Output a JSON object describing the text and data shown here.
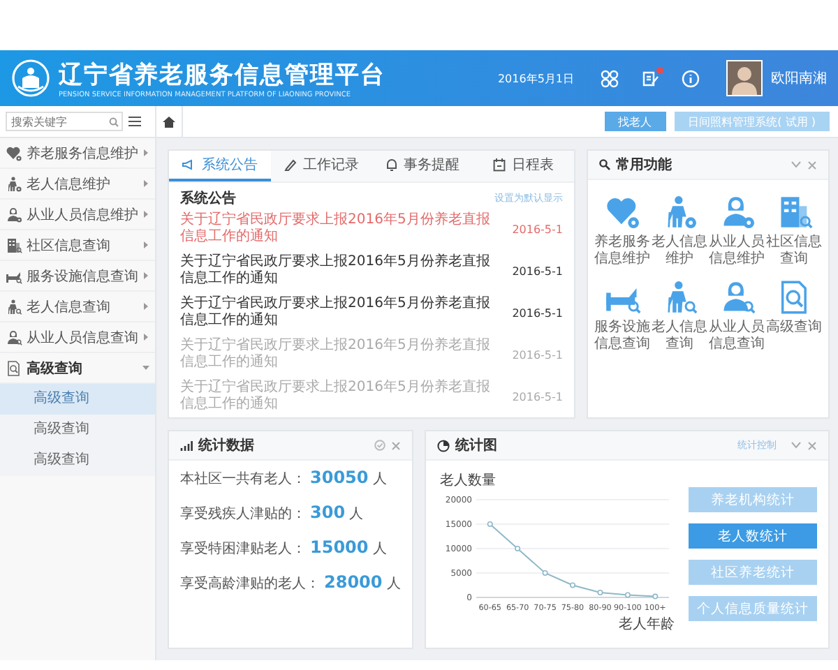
{
  "header": {
    "title": "辽宁省养老服务信息管理平台",
    "subtitle": "PENSION SERVICE INFORMATION MANAGEMENT PLATFORM OF LIAONING PROVINCE",
    "date": "2016年5月1日",
    "user": "欧阳南湘"
  },
  "toolbar": {
    "search": {
      "placeholder": "搜索关键字"
    },
    "buttons": [
      {
        "label": "找老人",
        "kind": "primary"
      },
      {
        "label": "日间照料管理系统( 试用 )",
        "kind": "light"
      }
    ]
  },
  "sidebar": {
    "items": [
      {
        "label": "养老服务信息维护",
        "expanded": false
      },
      {
        "label": "老人信息维护",
        "expanded": false
      },
      {
        "label": "从业人员信息维护",
        "expanded": false
      },
      {
        "label": "社区信息查询",
        "expanded": false
      },
      {
        "label": "服务设施信息查询",
        "expanded": false
      },
      {
        "label": "老人信息查询",
        "expanded": false
      },
      {
        "label": "从业人员信息查询",
        "expanded": false
      },
      {
        "label": "高级查询",
        "expanded": true,
        "children": [
          {
            "label": "高级查询",
            "selected": true
          },
          {
            "label": "高级查询",
            "selected": false
          },
          {
            "label": "高级查询",
            "selected": false
          }
        ]
      }
    ]
  },
  "notices": {
    "tabs": [
      {
        "label": "系统公告",
        "selected": true
      },
      {
        "label": "工作记录",
        "selected": false
      },
      {
        "label": "事务提醒",
        "selected": false
      },
      {
        "label": "日程表",
        "selected": false
      }
    ],
    "heading": "系统公告",
    "link": "设置为默认显示",
    "rows": [
      {
        "title": "关于辽宁省民政厅要求上报2016年5月份养老直报信息工作的通知",
        "date": "2016-5-1",
        "highlighted": true,
        "read": false
      },
      {
        "title": "关于辽宁省民政厅要求上报2016年5月份养老直报信息工作的通知",
        "date": "2016-5-1",
        "highlighted": false,
        "read": false
      },
      {
        "title": "关于辽宁省民政厅要求上报2016年5月份养老直报信息工作的通知",
        "date": "2016-5-1",
        "highlighted": false,
        "read": false
      },
      {
        "title": "关于辽宁省民政厅要求上报2016年5月份养老直报信息工作的通知",
        "date": "2016-5-1",
        "highlighted": false,
        "read": true
      },
      {
        "title": "关于辽宁省民政厅要求上报2016年5月份养老直报信息工作的通知",
        "date": "2016-5-1",
        "highlighted": false,
        "read": true
      }
    ]
  },
  "functions": {
    "title": "常用功能",
    "items": [
      {
        "label": "养老服务信息维护"
      },
      {
        "label": "老人信息维护"
      },
      {
        "label": "从业人员信息维护"
      },
      {
        "label": "社区信息查询"
      },
      {
        "label": "服务设施信息查询"
      },
      {
        "label": "老人信息查询"
      },
      {
        "label": "从业人员信息查询"
      },
      {
        "label": "高级查询"
      }
    ]
  },
  "stats": {
    "title": "统计数据",
    "rows": [
      {
        "label": "本社区一共有老人：",
        "value": "30050",
        "unit": "人"
      },
      {
        "label": "享受残疾人津贴的：",
        "value": "300",
        "unit": "人"
      },
      {
        "label": "享受特困津贴老人：",
        "value": "15000",
        "unit": "人"
      },
      {
        "label": "享受高龄津贴的老人：",
        "value": "28000",
        "unit": "人"
      }
    ]
  },
  "chart_panel": {
    "title": "统计图",
    "link": "统计控制",
    "chart_data": {
      "type": "line",
      "ylabel": "老人数量",
      "xlabel": "老人年龄",
      "categories": [
        "60-65",
        "65-70",
        "70-75",
        "75-80",
        "80-90",
        "90-100",
        "100+"
      ],
      "values": [
        15000,
        10000,
        5000,
        2500,
        1000,
        500,
        200
      ],
      "ylim": [
        0,
        20000
      ],
      "grid": true,
      "marker": true,
      "yticks": [
        0,
        5000,
        10000,
        15000,
        20000
      ]
    },
    "buttons": [
      {
        "label": "养老机构统计",
        "selected": false
      },
      {
        "label": "老人数统计",
        "selected": true
      },
      {
        "label": "社区养老统计",
        "selected": false
      },
      {
        "label": "个人信息质量统计",
        "selected": false
      }
    ]
  }
}
